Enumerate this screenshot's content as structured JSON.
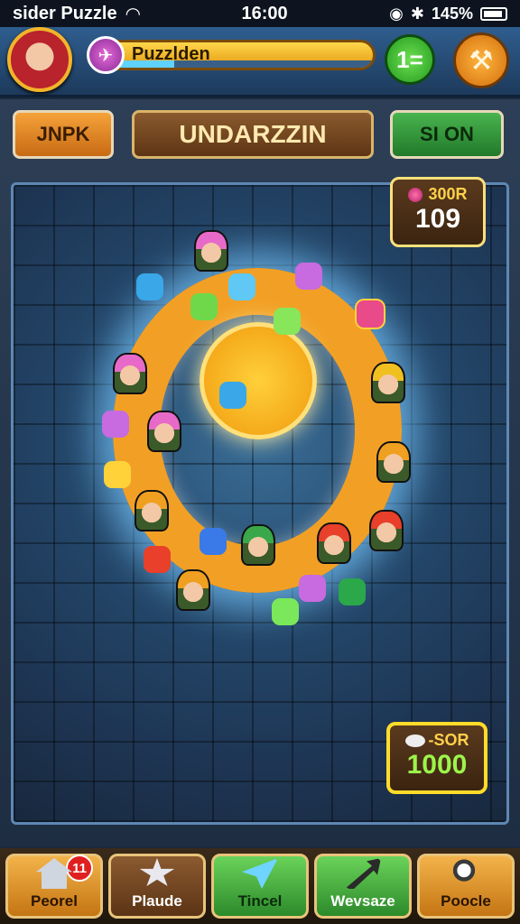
{
  "status_bar": {
    "app_name": "sider Puzzle",
    "time": "16:00",
    "battery": "145%"
  },
  "header": {
    "level_label": "Puzzlden",
    "level_progress": 0.3,
    "green_button_label": "1=",
    "colors": {
      "level_bar": "#e39a12",
      "green_button": "#249a1f",
      "action_button": "#d26e0b"
    }
  },
  "tabs": {
    "left": "JNPK",
    "title": "UNDARZZIN",
    "right": "SI ON"
  },
  "score_top": {
    "label": "300R",
    "value": "109"
  },
  "score_bottom": {
    "label": "-SOR",
    "value": "1000"
  },
  "bottom_nav": [
    {
      "label": "Peorel",
      "icon": "house-icon",
      "badge": "11"
    },
    {
      "label": "Plaude",
      "icon": "star-icon"
    },
    {
      "label": "Tincel",
      "icon": "paper-plane-icon"
    },
    {
      "label": "Wevsaze",
      "icon": "arrow-icon"
    },
    {
      "label": "Poocle",
      "icon": "search-icon"
    }
  ]
}
